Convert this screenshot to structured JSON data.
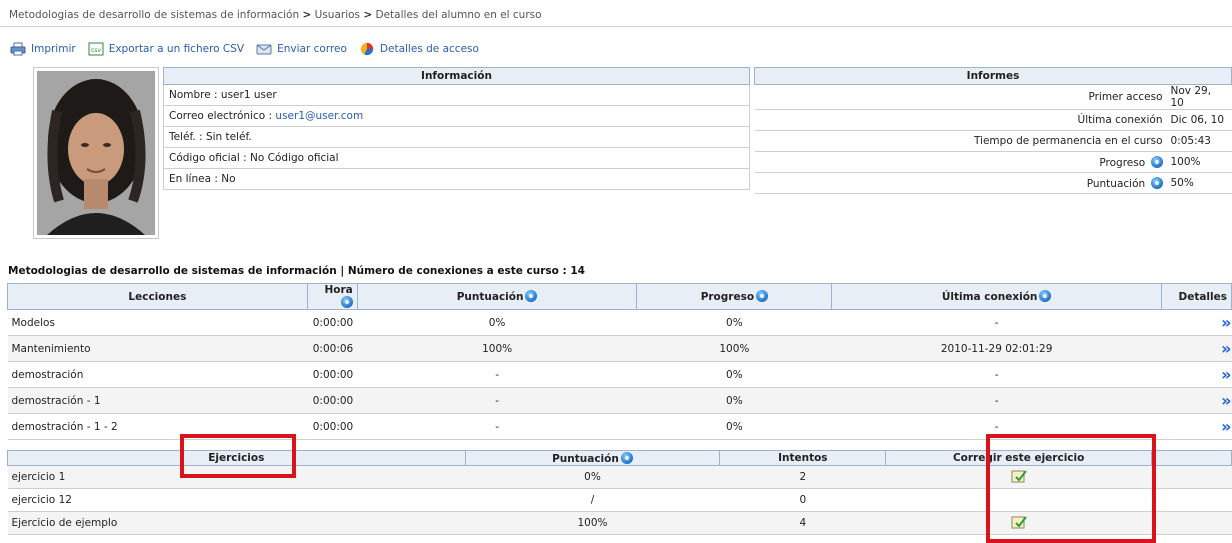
{
  "breadcrumb": {
    "items": [
      "Metodologias de desarrollo de sistemas de información",
      "Usuarios",
      "Detalles del alumno en el curso"
    ],
    "separator": ">"
  },
  "toolbar": {
    "print_label": "Imprimir",
    "csv_label": "Exportar a un fichero CSV",
    "email_label": "Enviar correo",
    "access_label": "Detalles de acceso"
  },
  "info": {
    "header": "Información",
    "name": "Nombre : user1 user",
    "email_prefix": "Correo electrónico : ",
    "email": "user1@user.com",
    "phone": "Teléf. : Sin teléf.",
    "official_code": "Código oficial : No Código oficial",
    "online": "En línea : No"
  },
  "reports": {
    "header": "Informes",
    "rows": [
      {
        "label": "Primer acceso",
        "value": "Nov 29, 10"
      },
      {
        "label": "Última conexión",
        "value": "Dic 06, 10"
      },
      {
        "label": "Tiempo de permanencia en el curso",
        "value": "0:05:43"
      },
      {
        "label": "Progreso",
        "value": "100%"
      },
      {
        "label": "Puntuación",
        "value": "50%"
      }
    ]
  },
  "course": {
    "title": "Metodologias de desarrollo de sistemas de información | Número de conexiones a este curso : 14"
  },
  "lessons": {
    "headers": [
      "Lecciones",
      "Hora",
      "Puntuación",
      "Progreso",
      "Última conexión",
      "Detalles"
    ],
    "rows": [
      {
        "name": "Modelos",
        "time": "0:00:00",
        "score": "0%",
        "progress": "0%",
        "last": "-"
      },
      {
        "name": "Mantenimiento",
        "time": "0:00:06",
        "score": "100%",
        "progress": "100%",
        "last": "2010-11-29 02:01:29"
      },
      {
        "name": "demostración",
        "time": "0:00:00",
        "score": "-",
        "progress": "0%",
        "last": "-"
      },
      {
        "name": "demostración - 1",
        "time": "0:00:00",
        "score": "-",
        "progress": "0%",
        "last": "-"
      },
      {
        "name": "demostración - 1 - 2",
        "time": "0:00:00",
        "score": "-",
        "progress": "0%",
        "last": "-"
      }
    ],
    "details_glyph": "»"
  },
  "exercises": {
    "headers": [
      "Ejercicios",
      "Puntuación",
      "Intentos",
      "Corregir este ejercicio"
    ],
    "rows": [
      {
        "name": "ejercicio 1",
        "score": "0%",
        "attempts": "2",
        "correct": true
      },
      {
        "name": "ejercicio 12",
        "score": "/",
        "attempts": "0",
        "correct": false
      },
      {
        "name": "Ejercicio de ejemplo",
        "score": "100%",
        "attempts": "4",
        "correct": true
      }
    ]
  },
  "colors": {
    "header_bg": "#e8eef6",
    "header_border": "#9fb1cc",
    "link": "#2a5db0",
    "highlight": "#d8141a",
    "chevron": "#1a5fd1"
  },
  "icons": [
    "printer-icon",
    "csv-icon",
    "email-icon",
    "pie-chart-icon",
    "info-icon",
    "chevron-double-right-icon",
    "edit-exercise-icon"
  ]
}
